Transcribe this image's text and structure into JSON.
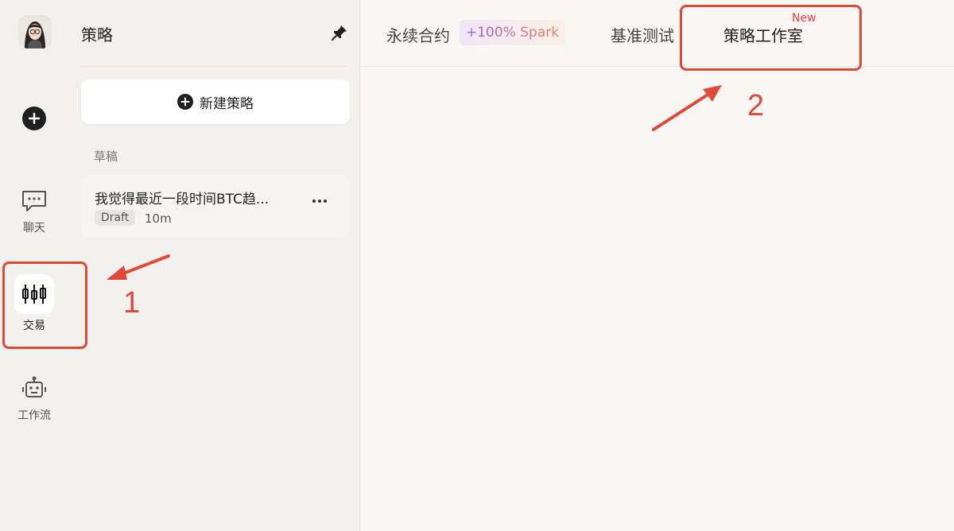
{
  "rail": {
    "items": [
      {
        "label": "聊天",
        "icon": "chat-icon"
      },
      {
        "label": "交易",
        "icon": "candlestick-icon",
        "active": true
      },
      {
        "label": "工作流",
        "icon": "robot-icon"
      }
    ]
  },
  "sidebar": {
    "title": "策略",
    "create_label": "新建策略",
    "section_label": "草稿",
    "drafts": [
      {
        "title": "我觉得最近一段时间BTC趋...",
        "status": "Draft",
        "age": "10m"
      }
    ]
  },
  "tabs": {
    "items": [
      {
        "label": "永续合约"
      },
      {
        "label": "基准测试"
      },
      {
        "label": "策略工作室"
      }
    ],
    "spark_badge": "+100% Spark",
    "new_badge": "New"
  },
  "annotations": {
    "one": "1",
    "two": "2",
    "color": "#e0493a"
  }
}
